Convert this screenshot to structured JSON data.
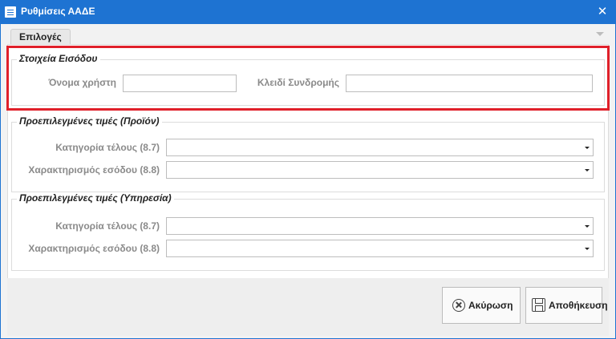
{
  "window": {
    "title": "Ρυθμίσεις ΑΑΔΕ",
    "close_glyph": "✕"
  },
  "tabs": [
    {
      "label": "Επιλογές"
    }
  ],
  "login": {
    "title": "Στοιχεία Εισόδου",
    "username_label": "Όνομα χρήστη",
    "username_value": "",
    "key_label": "Κλειδί Συνδρομής",
    "key_value": ""
  },
  "product_defaults": {
    "title": "Προεπιλεγμένες τιμές (Προϊόν)",
    "fee_category_label": "Κατηγορία τέλους (8.7)",
    "fee_category_value": "",
    "income_class_label": "Χαρακτηρισμός εσόδου (8.8)",
    "income_class_value": ""
  },
  "service_defaults": {
    "title": "Προεπιλεγμένες τιμές (Υπηρεσία)",
    "fee_category_label": "Κατηγορία τέλους (8.7)",
    "fee_category_value": "",
    "income_class_label": "Χαρακτηρισμός εσόδου (8.8)",
    "income_class_value": ""
  },
  "footer": {
    "cancel_label": "Ακύρωση",
    "save_label": "Αποθήκευση"
  },
  "colors": {
    "titlebar": "#1e73d2",
    "highlight": "#e0202a"
  },
  "icons": {
    "window": "settings-window-icon",
    "close": "close-icon",
    "cancel": "cancel-circle-icon",
    "save": "save-floppy-icon"
  }
}
